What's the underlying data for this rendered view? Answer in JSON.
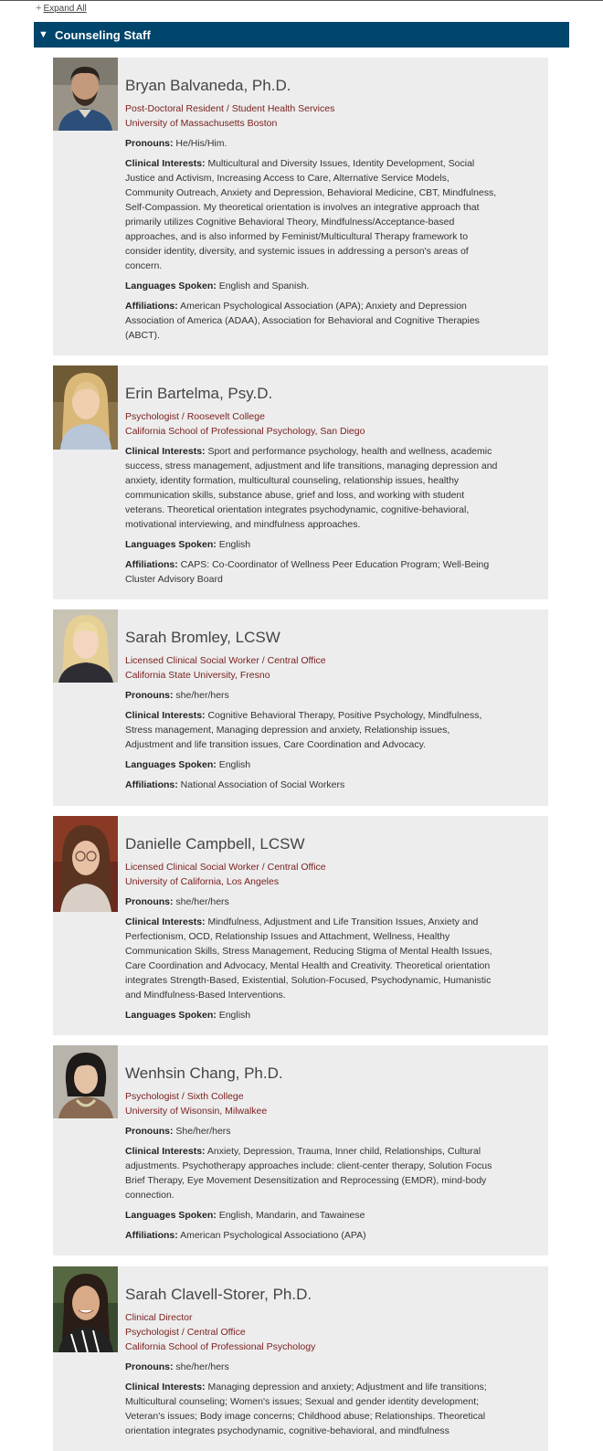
{
  "expand_all": "Expand All",
  "section_title": "Counseling Staff",
  "staff": [
    {
      "name": "Bryan Balvaneda, Ph.D.",
      "roles": [
        "Post-Doctoral Resident / Student Health Services",
        "University of Massachusetts Boston"
      ],
      "pronouns": "He/His/Him.",
      "clinical": "Multicultural and Diversity Issues, Identity Development, Social Justice and Activism, Increasing Access to Care, Alternative Service Models, Community Outreach, Anxiety and Depression, Behavioral Medicine, CBT, Mindfulness, Self-Compassion. My theoretical orientation is involves an integrative approach that primarily utilizes Cognitive Behavioral Theory, Mindfulness/Acceptance-based approaches, and is also informed by Feminist/Multicultural Therapy framework to consider identity, diversity, and systemic issues in addressing a person's areas of concern.",
      "languages": "English and Spanish.",
      "affiliations": "American Psychological Association (APA); Anxiety and Depression Association of America (ADAA), Association for Behavioral and Cognitive Therapies (ABCT)."
    },
    {
      "name": "Erin Bartelma, Psy.D.",
      "roles": [
        "Psychologist / Roosevelt College",
        "California School of Professional Psychology, San Diego"
      ],
      "pronouns": null,
      "clinical": "Sport and performance psychology, health and wellness, academic success, stress management, adjustment and life transitions, managing depression and anxiety, identity formation, multicultural counseling, relationship issues, healthy communication skills, substance abuse, grief and loss, and working with student veterans. Theoretical orientation integrates psychodynamic, cognitive-behavioral, motivational interviewing, and mindfulness approaches.",
      "languages": "English",
      "affiliations": "CAPS: Co-Coordinator of Wellness Peer Education Program; Well-Being Cluster Advisory Board"
    },
    {
      "name": "Sarah Bromley, LCSW",
      "roles": [
        "Licensed Clinical Social Worker / Central Office",
        "California State University, Fresno"
      ],
      "pronouns": "she/her/hers",
      "clinical": "Cognitive Behavioral Therapy, Positive Psychology, Mindfulness, Stress management, Managing depression and anxiety, Relationship issues, Adjustment and life transition issues, Care Coordination and Advocacy.",
      "languages": "English",
      "affiliations": "National Association of Social Workers"
    },
    {
      "name": "Danielle Campbell, LCSW",
      "roles": [
        "Licensed Clinical Social Worker / Central Office",
        "University of California, Los Angeles"
      ],
      "pronouns": "she/her/hers",
      "clinical": "Mindfulness, Adjustment and Life Transition Issues, Anxiety and Perfectionism, OCD, Relationship Issues and Attachment, Wellness, Healthy Communication Skills, Stress Management, Reducing Stigma of Mental Health Issues, Care Coordination and Advocacy, Mental Health and Creativity. Theoretical orientation integrates Strength-Based, Existential, Solution-Focused, Psychodynamic, Humanistic and Mindfulness-Based Interventions.",
      "languages": "English",
      "affiliations": null
    },
    {
      "name": "Wenhsin Chang, Ph.D.",
      "roles": [
        "Psychologist / Sixth College",
        "University of Wisonsin, Milwalkee"
      ],
      "pronouns": "She/her/hers",
      "clinical": "Anxiety, Depression, Trauma, Inner child, Relationships, Cultural adjustments. Psychotherapy approaches  include: client-center therapy, Solution Focus Brief Therapy, Eye Movement Desensitization and Reprocessing (EMDR), mind-body connection.",
      "languages": "English, Mandarin, and Tawainese",
      "affiliations": "American Psychological Associationo (APA)"
    },
    {
      "name": "Sarah Clavell-Storer, Ph.D.",
      "roles": [
        "Clinical Director",
        "Psychologist / Central Office",
        "California School of Professional Psychology"
      ],
      "pronouns": "she/her/hers",
      "clinical": "Managing depression and anxiety; Adjustment and life transitions; Multicultural counseling; Women's issues; Sexual and gender identity development; Veteran's issues; Body image concerns; Childhood abuse; Relationships. Theoretical orientation integrates psychodynamic, cognitive-behavioral, and mindfulness",
      "languages": null,
      "affiliations": null
    }
  ],
  "labels": {
    "pronouns": "Pronouns:",
    "clinical": "Clinical Interests:",
    "languages": "Languages Spoken:",
    "affiliations": "Affiliations:"
  }
}
